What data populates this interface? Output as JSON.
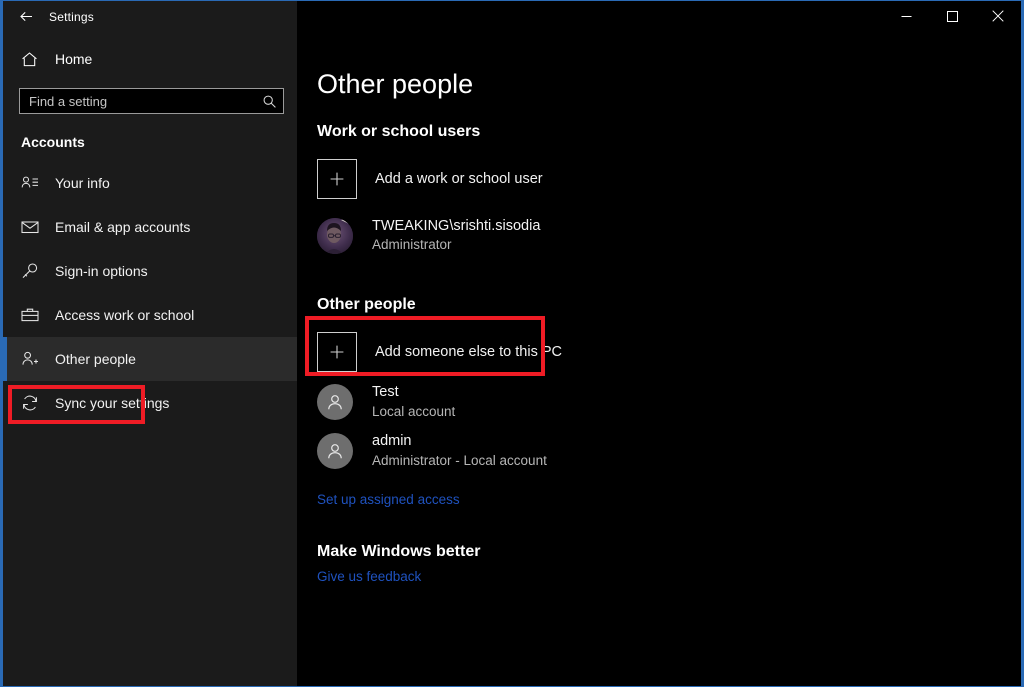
{
  "window": {
    "title": "Settings",
    "back_icon": "back-arrow-icon",
    "controls": {
      "minimize": "minimize-icon",
      "maximize": "maximize-icon",
      "close": "close-icon"
    },
    "accent_color": "#2a6ab5",
    "highlight_color": "#ef1c25"
  },
  "sidebar": {
    "home": {
      "label": "Home",
      "icon": "home-icon"
    },
    "search": {
      "placeholder": "Find a setting",
      "value": "",
      "icon": "search-icon"
    },
    "section_title": "Accounts",
    "items": [
      {
        "label": "Your info",
        "icon": "user-info-icon",
        "selected": false
      },
      {
        "label": "Email & app accounts",
        "icon": "envelope-icon",
        "selected": false
      },
      {
        "label": "Sign-in options",
        "icon": "key-icon",
        "selected": false
      },
      {
        "label": "Access work or school",
        "icon": "briefcase-icon",
        "selected": false
      },
      {
        "label": "Other people",
        "icon": "user-plus-icon",
        "selected": true
      },
      {
        "label": "Sync your settings",
        "icon": "sync-icon",
        "selected": false
      }
    ]
  },
  "main": {
    "page_title": "Other people",
    "work_section": {
      "heading": "Work or school users",
      "add_label": "Add a work or school user",
      "add_icon": "plus-box-icon",
      "users": [
        {
          "name": "TWEAKING\\srishti.sisodia",
          "subtitle": "Administrator",
          "avatar": "user-photo-avatar"
        }
      ]
    },
    "other_section": {
      "heading": "Other people",
      "add_label": "Add someone else to this PC",
      "add_icon": "plus-box-icon",
      "users": [
        {
          "name": "Test",
          "subtitle": "Local account",
          "avatar": "generic-person-icon"
        },
        {
          "name": "admin",
          "subtitle": "Administrator - Local account",
          "avatar": "generic-person-icon"
        }
      ],
      "assigned_access_link": "Set up assigned access"
    },
    "feedback_section": {
      "heading": "Make Windows better",
      "link": "Give us feedback"
    }
  }
}
